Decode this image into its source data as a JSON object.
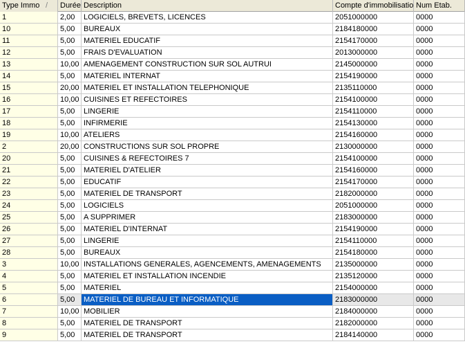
{
  "columns": [
    "Type Immo",
    "Durée",
    "Description",
    "Compte d'immobilisation",
    "Num Etab."
  ],
  "sort_indicator": "/",
  "selected_index": 24,
  "rows": [
    {
      "type": "1",
      "duree": "2,00",
      "description": "LOGICIELS, BREVETS, LICENCES",
      "compte": "2051000000",
      "etab": "0000"
    },
    {
      "type": "10",
      "duree": "5,00",
      "description": "BUREAUX",
      "compte": "2184180000",
      "etab": "0000"
    },
    {
      "type": "11",
      "duree": "5,00",
      "description": "MATERIEL EDUCATIF",
      "compte": "2154170000",
      "etab": "0000"
    },
    {
      "type": "12",
      "duree": "5,00",
      "description": "FRAIS D'EVALUATION",
      "compte": "2013000000",
      "etab": "0000"
    },
    {
      "type": "13",
      "duree": "10,00",
      "description": "AMENAGEMENT CONSTRUCTION SUR SOL AUTRUI",
      "compte": "2145000000",
      "etab": "0000"
    },
    {
      "type": "14",
      "duree": "5,00",
      "description": "MATERIEL INTERNAT",
      "compte": "2154190000",
      "etab": "0000"
    },
    {
      "type": "15",
      "duree": "20,00",
      "description": "MATERIEL ET INSTALLATION TELEPHONIQUE",
      "compte": "2135110000",
      "etab": "0000"
    },
    {
      "type": "16",
      "duree": "10,00",
      "description": "CUISINES ET REFECTOIRES",
      "compte": "2154100000",
      "etab": "0000"
    },
    {
      "type": "17",
      "duree": "5,00",
      "description": "LINGERIE",
      "compte": "2154110000",
      "etab": "0000"
    },
    {
      "type": "18",
      "duree": "5,00",
      "description": "INFIRMERIE",
      "compte": "2154130000",
      "etab": "0000"
    },
    {
      "type": "19",
      "duree": "10,00",
      "description": "ATELIERS",
      "compte": "2154160000",
      "etab": "0000"
    },
    {
      "type": "2",
      "duree": "20,00",
      "description": "CONSTRUCTIONS SUR SOL  PROPRE",
      "compte": "2130000000",
      "etab": "0000"
    },
    {
      "type": "20",
      "duree": "5,00",
      "description": "CUISINES & REFECTOIRES 7",
      "compte": "2154100000",
      "etab": "0000"
    },
    {
      "type": "21",
      "duree": "5,00",
      "description": "MATERIEL D'ATELIER",
      "compte": "2154160000",
      "etab": "0000"
    },
    {
      "type": "22",
      "duree": "5,00",
      "description": "EDUCATIF",
      "compte": "2154170000",
      "etab": "0000"
    },
    {
      "type": "23",
      "duree": "5,00",
      "description": "MATERIEL DE TRANSPORT",
      "compte": "2182000000",
      "etab": "0000"
    },
    {
      "type": "24",
      "duree": "5,00",
      "description": "LOGICIELS",
      "compte": "2051000000",
      "etab": "0000"
    },
    {
      "type": "25",
      "duree": "5,00",
      "description": "A SUPPRIMER",
      "compte": "2183000000",
      "etab": "0000"
    },
    {
      "type": "26",
      "duree": "5,00",
      "description": "MATERIEL D'INTERNAT",
      "compte": "2154190000",
      "etab": "0000"
    },
    {
      "type": "27",
      "duree": "5,00",
      "description": "LINGERIE",
      "compte": "2154110000",
      "etab": "0000"
    },
    {
      "type": "28",
      "duree": "5,00",
      "description": "BUREAUX",
      "compte": "2154180000",
      "etab": "0000"
    },
    {
      "type": "3",
      "duree": "10,00",
      "description": "INSTALLATIONS GENERALES, AGENCEMENTS, AMENAGEMENTS",
      "compte": "2135000000",
      "etab": "0000"
    },
    {
      "type": "4",
      "duree": "5,00",
      "description": "MATERIEL ET INSTALLATION INCENDIE",
      "compte": "2135120000",
      "etab": "0000"
    },
    {
      "type": "5",
      "duree": "5,00",
      "description": "MATERIEL",
      "compte": "2154000000",
      "etab": "0000"
    },
    {
      "type": "6",
      "duree": "5,00",
      "description": "MATERIEL DE BUREAU ET INFORMATIQUE",
      "compte": "2183000000",
      "etab": "0000"
    },
    {
      "type": "7",
      "duree": "10,00",
      "description": "MOBILIER",
      "compte": "2184000000",
      "etab": "0000"
    },
    {
      "type": "8",
      "duree": "5,00",
      "description": "MATERIEL DE TRANSPORT",
      "compte": "2182000000",
      "etab": "0000"
    },
    {
      "type": "9",
      "duree": "5,00",
      "description": "MATERIEL DE TRANSPORT",
      "compte": "2184140000",
      "etab": "0000"
    }
  ]
}
